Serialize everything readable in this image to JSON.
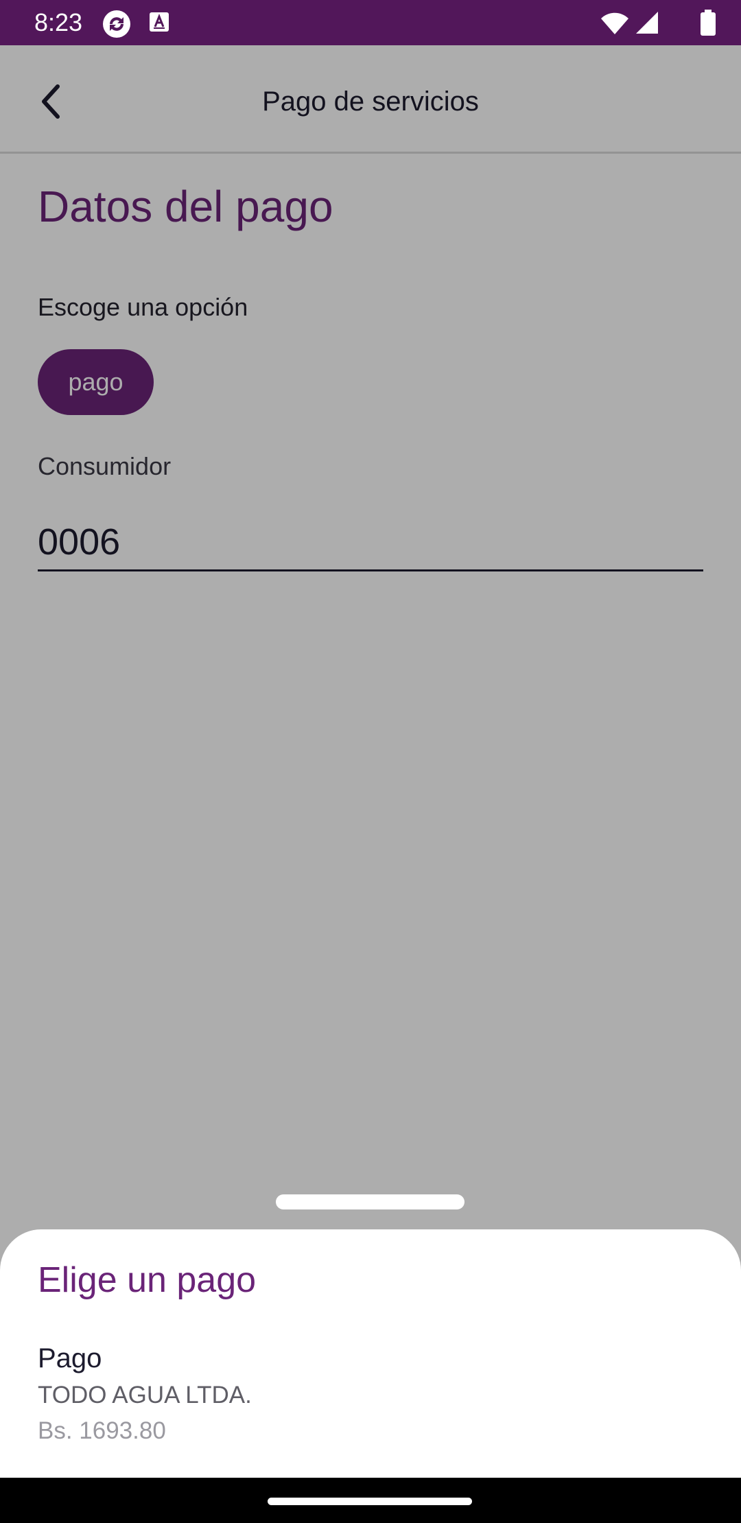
{
  "status_bar": {
    "time": "8:23",
    "icons": [
      "sync-icon",
      "tile-icon",
      "wifi-icon",
      "signal-icon",
      "battery-icon"
    ]
  },
  "app_bar": {
    "title": "Pago de servicios",
    "back_icon": "chevron-left-icon"
  },
  "main": {
    "heading": "Datos del pago",
    "option_label": "Escoge una opción",
    "chip_label": "pago",
    "consumer_label": "Consumidor",
    "consumer_value": "0006"
  },
  "sheet": {
    "title": "Elige un pago",
    "items": [
      {
        "name": "Pago",
        "company": "TODO AGUA LTDA.",
        "amount": "Bs. 1693.80"
      }
    ]
  },
  "colors": {
    "status_bar": "#52175a",
    "accent": "#6a2478",
    "scrim": "rgba(0,0,0,0.32)"
  }
}
